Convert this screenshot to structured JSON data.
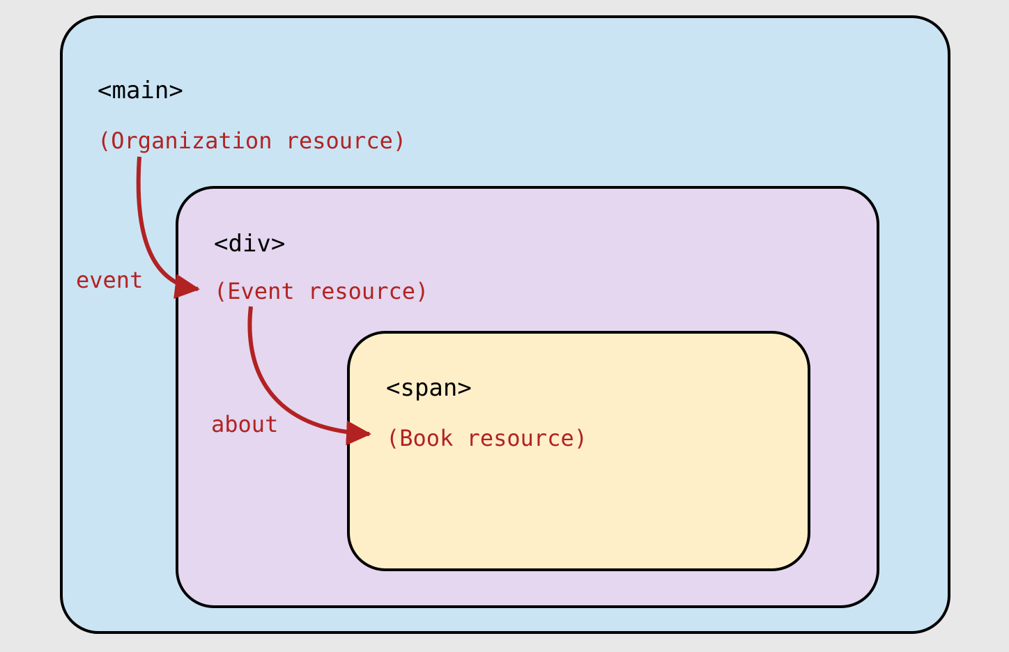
{
  "boxes": {
    "main": {
      "tag": "<main>",
      "resource": "(Organization resource)"
    },
    "div": {
      "tag": "<div>",
      "resource": "(Event resource)"
    },
    "span": {
      "tag": "<span>",
      "resource": "(Book resource)"
    }
  },
  "edges": {
    "event": {
      "label": "event",
      "from": "main",
      "to": "div"
    },
    "about": {
      "label": "about",
      "from": "div",
      "to": "span"
    }
  }
}
